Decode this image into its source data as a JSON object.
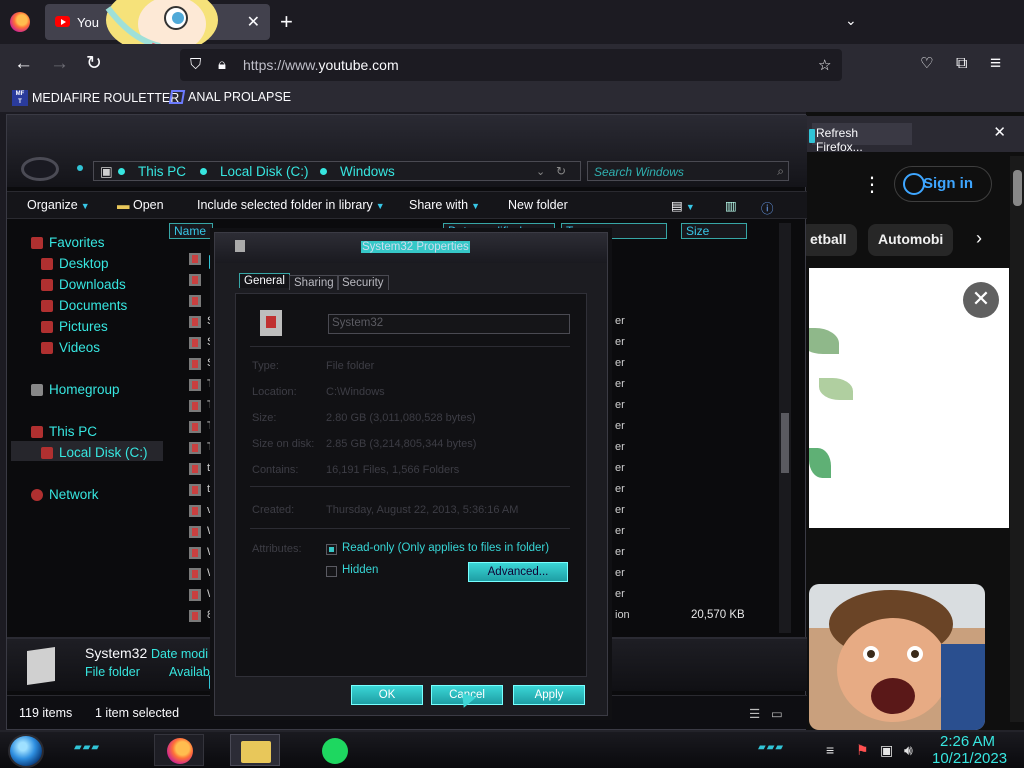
{
  "browser": {
    "tab_title": "You",
    "url_prefix": "https://www.",
    "url_domain": "youtube.com",
    "bookmarks": [
      {
        "label": "MEDIAFIRE ROULETTER",
        "icon": "mediafire-icon"
      },
      {
        "label": "ANAL PROLAPSE",
        "icon": "bookmark-logo-icon"
      }
    ]
  },
  "youtube": {
    "refresh_label": "Refresh Firefox...",
    "signin_label": "Sign in",
    "chips": [
      "etball",
      "Automobi"
    ]
  },
  "explorer": {
    "breadcrumbs": [
      "This PC",
      "Local Disk (C:)",
      "Windows"
    ],
    "search_placeholder": "Search Windows",
    "toolbar": {
      "organize": "Organize",
      "open": "Open",
      "include": "Include selected folder in library",
      "share": "Share with",
      "new_folder": "New folder"
    },
    "nav": {
      "favorites": "Favorites",
      "desktop": "Desktop",
      "downloads": "Downloads",
      "documents": "Documents",
      "pictures": "Pictures",
      "videos": "Videos",
      "homegroup": "Homegroup",
      "this_pc": "This PC",
      "local_disk": "Local Disk (C:)",
      "network": "Network"
    },
    "columns": {
      "name": "Name",
      "date": "Date modified",
      "type": "Type",
      "size": "Size"
    },
    "rows": [
      {
        "ch": "",
        "type": "",
        "size": ""
      },
      {
        "ch": "",
        "type": "",
        "size": ""
      },
      {
        "ch": "",
        "type": "",
        "size": ""
      },
      {
        "ch": "S",
        "type": "er",
        "size": ""
      },
      {
        "ch": "S",
        "type": "er",
        "size": ""
      },
      {
        "ch": "S",
        "type": "er",
        "size": ""
      },
      {
        "ch": "T",
        "type": "er",
        "size": ""
      },
      {
        "ch": "Ta",
        "type": "er",
        "size": ""
      },
      {
        "ch": "Te",
        "type": "er",
        "size": ""
      },
      {
        "ch": "Te",
        "type": "er",
        "size": ""
      },
      {
        "ch": "tr",
        "type": "er",
        "size": ""
      },
      {
        "ch": "tv",
        "type": "er",
        "size": ""
      },
      {
        "ch": "vj",
        "type": "er",
        "size": ""
      },
      {
        "ch": "W",
        "type": "er",
        "size": ""
      },
      {
        "ch": "W",
        "type": "er",
        "size": ""
      },
      {
        "ch": "W",
        "type": "er",
        "size": ""
      },
      {
        "ch": "W",
        "type": "er",
        "size": ""
      },
      {
        "ch": "8",
        "type": "ion",
        "size": "20,570 KB"
      }
    ],
    "details": {
      "name": "System32",
      "date_label": "Date modi",
      "kind": "File folder",
      "avail": "Availab"
    },
    "status": {
      "items": "119 items",
      "selected": "1 item selected"
    }
  },
  "dialog": {
    "title": "System32 Properties",
    "tabs": [
      "General",
      "Sharing",
      "Security"
    ],
    "name_value": "System32",
    "props": [
      {
        "label": "Type:",
        "value": "File folder"
      },
      {
        "label": "Location:",
        "value": "C:\\Windows"
      },
      {
        "label": "Size:",
        "value": "2.80 GB (3,011,080,528 bytes)"
      },
      {
        "label": "Size on disk:",
        "value": "2.85 GB (3,214,805,344 bytes)"
      },
      {
        "label": "Contains:",
        "value": "16,191 Files, 1,566 Folders"
      },
      {
        "label": "Created:",
        "value": "Thursday, August 22, 2013, 5:36:16 AM"
      },
      {
        "label": "Attributes:",
        "value": ""
      }
    ],
    "readonly_label": "Read-only (Only applies to files in folder)",
    "hidden_label": "Hidden",
    "advanced_label": "Advanced...",
    "ok_label": "OK",
    "cancel_label": "Cancel",
    "apply_label": "Apply"
  },
  "taskbar": {
    "time": "2:26 AM",
    "date": "10/21/2023"
  }
}
